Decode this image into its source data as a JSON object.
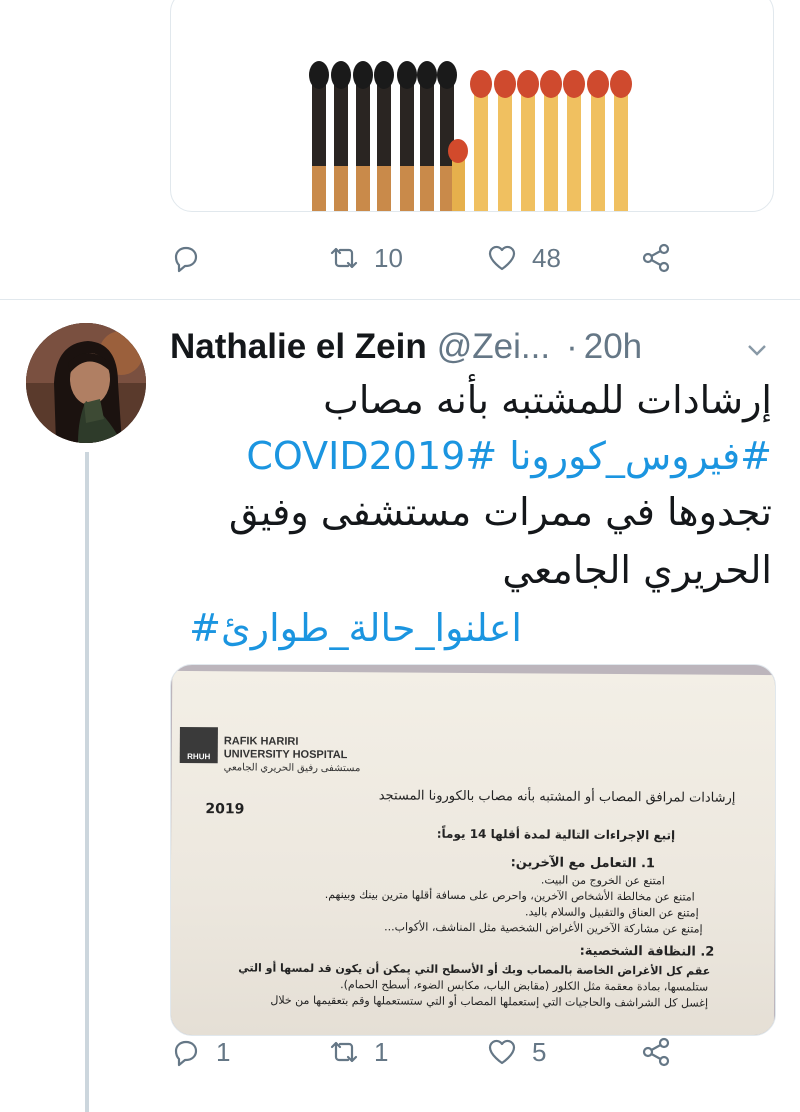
{
  "previous_tweet": {
    "actions": {
      "reply_count": "",
      "retweet_count": "10",
      "like_count": "48"
    },
    "image": {
      "description_icon": "burnt-matches-image"
    }
  },
  "tweet": {
    "author_name": "Nathalie el Zein",
    "author_handle": "@Zei...",
    "separator": "·",
    "time": "20h",
    "text_lines": [
      "إرشادات للمشتبه بأنه مصاب",
      "#فيروس_كورونا #COVID2019",
      "تجدوها في ممرات مستشفى وفيق",
      "الحريري الجامعي",
      "اعلنوا_حالة_طوارئ#"
    ],
    "actions": {
      "reply_count": "1",
      "retweet_count": "1",
      "like_count": "5"
    },
    "document": {
      "logo_abbr": "RHUH",
      "hospital_en_1": "RAFIK HARIRI",
      "hospital_en_2": "UNIVERSITY HOSPITAL",
      "hospital_ar": "مستشفى رفيق الحريري الجامعي",
      "title": "إرشادات لمرافق المصاب أو المشتبه بأنه مصاب بالكورونا المستجد",
      "year": "2019",
      "intro": "إتبع الإجراءات التالية لمدة أقلها 14 يوماً:",
      "section1_title": "1. التعامل مع الآخرين:",
      "section1_items": [
        "امتنع عن الخروج من البيت.",
        "امتنع عن مخالطة الأشخاص الآخرين، واحرص على مسافة أقلها مترين بينك وبينهم.",
        "إمتنع عن العناق والتقبيل والسلام باليد.",
        "إمتنع عن مشاركة الآخرين الأغراض الشخصية مثل المناشف، الأكواب..."
      ],
      "section2_title": "2. النظافة الشخصية:",
      "section2_items": [
        "عقم كل الأغراض الخاصة بالمصاب وبك أو الأسطح التي يمكن أن يكون قد لمسها أو التي",
        "ستلمسها، بمادة معقمة مثل الكلور (مقابض الباب، مكابس الضوء، أسطح الحمام).",
        "إغسل كل الشراشف والحاجيات التي إستعملها المصاب أو التي ستستعملها وقم بتعقيمها من خلال"
      ]
    }
  },
  "colors": {
    "link_blue": "#1b95e0",
    "secondary_text": "#657786",
    "border": "#e1e8ed"
  }
}
